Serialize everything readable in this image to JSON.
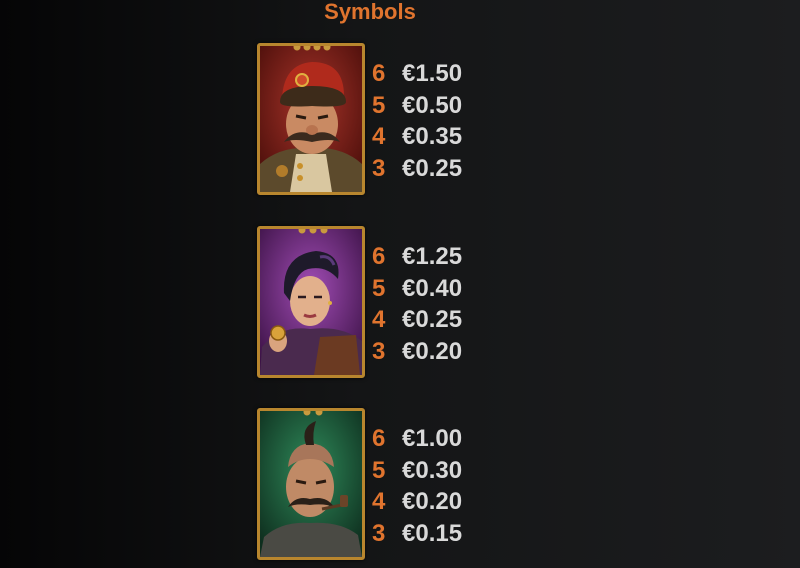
{
  "title": "Symbols",
  "symbols": [
    {
      "icon": "cossack-captain-icon",
      "payouts": [
        {
          "count": "6",
          "value": "€1.50"
        },
        {
          "count": "5",
          "value": "€0.50"
        },
        {
          "count": "4",
          "value": "€0.35"
        },
        {
          "count": "3",
          "value": "€0.25"
        }
      ]
    },
    {
      "icon": "woman-with-coin-icon",
      "payouts": [
        {
          "count": "6",
          "value": "€1.25"
        },
        {
          "count": "5",
          "value": "€0.40"
        },
        {
          "count": "4",
          "value": "€0.25"
        },
        {
          "count": "3",
          "value": "€0.20"
        }
      ]
    },
    {
      "icon": "cossack-with-pipe-icon",
      "payouts": [
        {
          "count": "6",
          "value": "€1.00"
        },
        {
          "count": "5",
          "value": "€0.30"
        },
        {
          "count": "4",
          "value": "€0.20"
        },
        {
          "count": "3",
          "value": "€0.15"
        }
      ]
    }
  ],
  "colors": {
    "accent": "#e0742e",
    "value_text": "#d9d9d9",
    "card_frame": "#b8862e"
  }
}
